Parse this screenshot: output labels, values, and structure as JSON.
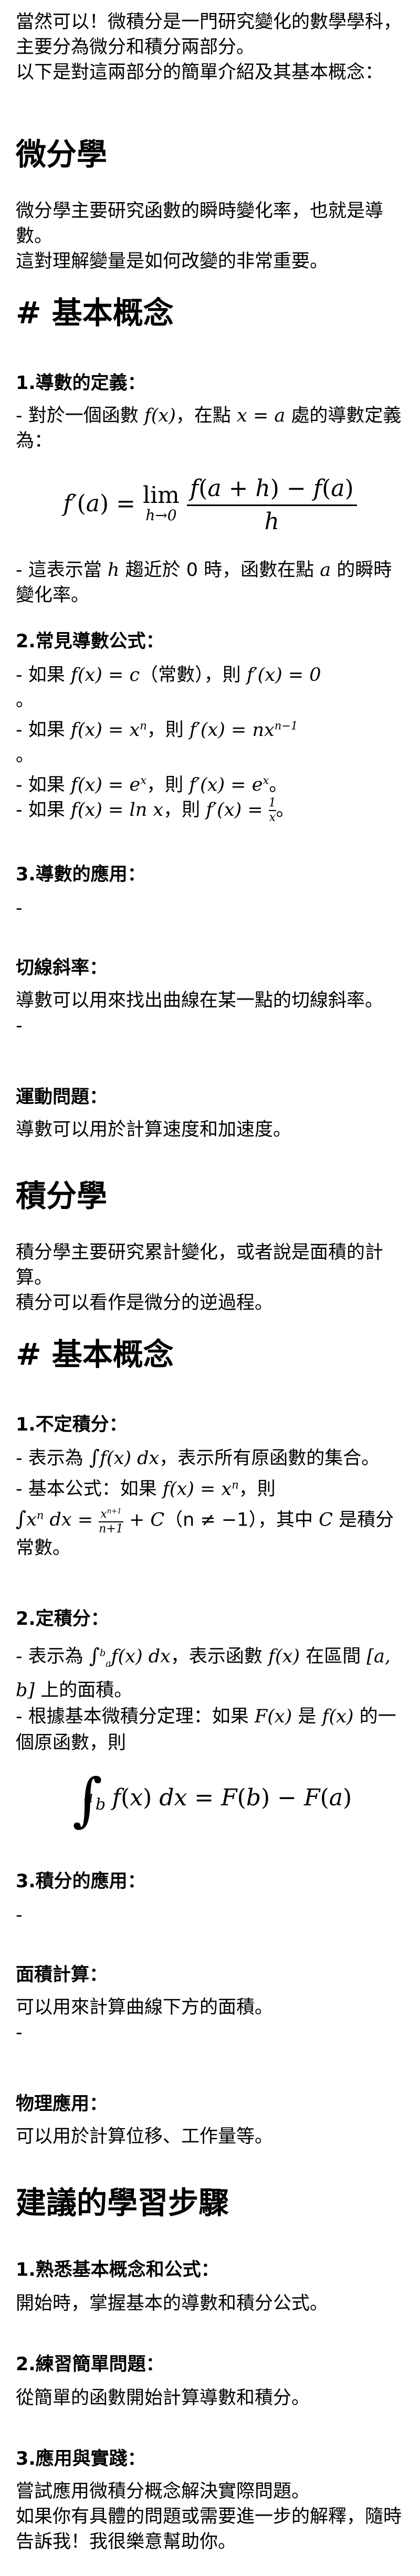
{
  "intro": {
    "line1": "當然可以！微積分是一門研究變化的數學學科，主要分為微分和積分兩部分。",
    "line2": "以下是對這兩部分的簡單介紹及其基本概念："
  },
  "differential": {
    "title": "微分學",
    "desc1": "微分學主要研究函數的瞬時變化率，也就是導數。",
    "desc2": "這對理解變量是如何改變的非常重要。",
    "concepts_heading": "# 基本概念",
    "definition": {
      "heading": "1.導數的定義：",
      "text_pre": "- 對於一個函數 ",
      "text_mid": "，在點 ",
      "text_post": " 處的導數定義為：",
      "note_pre": "- 這表示當 ",
      "note_mid": " 趨近於 0 時，函數在點 ",
      "note_post": " 的瞬時變化率。"
    },
    "common": {
      "heading": "2.常見導數公式：",
      "items": [
        {
          "pre": "- 如果 ",
          "f": "f(x) = c",
          "paren": "（常數）",
          "then": "，則 ",
          "d": "f′(x) = 0",
          "end": "。"
        },
        {
          "pre": "- 如果 ",
          "f": "f(x) = x",
          "then": "，則 ",
          "d": "f′(x) = nx",
          "end": "。"
        },
        {
          "pre": "- 如果 ",
          "f": "f(x) = e",
          "then": "，則 ",
          "d": "f′(x) = e",
          "end": "。"
        },
        {
          "pre": "- 如果 ",
          "f": "f(x) = ln x",
          "then": "，則 ",
          "d": "f′(x) = ",
          "end": "。"
        }
      ]
    },
    "application": {
      "heading": "3.導數的應用：",
      "dash": "-",
      "tangent_heading": "切線斜率：",
      "tangent_text": "導數可以用來找出曲線在某一點的切線斜率。",
      "tangent_dash": "-",
      "motion_heading": "運動問題：",
      "motion_text": "導數可以用於計算速度和加速度。"
    }
  },
  "integral": {
    "title": "積分學",
    "desc1": "積分學主要研究累計變化，或者說是面積的計算。",
    "desc2": "積分可以看作是微分的逆過程。",
    "concepts_heading": "# 基本概念",
    "indefinite": {
      "heading": "1.不定積分：",
      "l1_pre": "- 表示為 ",
      "l1_post": "，表示所有原函數的集合。",
      "l2_pre": "- 基本公式：如果 ",
      "l2_mid": "，則",
      "l3_cond": "（n ≠ −1）",
      "l3_post": "，其中 ",
      "l3_end": " 是積分常數。"
    },
    "definite": {
      "heading": "2.定積分：",
      "l1_pre": "- 表示為 ",
      "l1_mid": "，表示函數 ",
      "l1_post": " 在區間 ",
      "l1_end": " 上的面積。",
      "l2_pre": "- 根據基本微積分定理：如果 ",
      "l2_mid": " 是 ",
      "l2_post": " 的一個原函數，則"
    },
    "application": {
      "heading": "3.積分的應用：",
      "dash": "-",
      "area_heading": "面積計算：",
      "area_text": "可以用來計算曲線下方的面積。",
      "area_dash": "-",
      "physics_heading": "物理應用：",
      "physics_text": "可以用於計算位移、工作量等。"
    }
  },
  "steps": {
    "title": "建議的學習步驟",
    "s1_heading": "1.熟悉基本概念和公式：",
    "s1_text": "開始時，掌握基本的導數和積分公式。",
    "s2_heading": "2.練習簡單問題：",
    "s2_text": "從簡單的函數開始計算導數和積分。",
    "s3_heading": "3.應用與實踐：",
    "s3_text1": "嘗試應用微積分概念解決實際問題。",
    "s3_text2": "如果你有具體的問題或需要進一步的解釋，隨時告訴我！我很樂意幫助你。"
  }
}
